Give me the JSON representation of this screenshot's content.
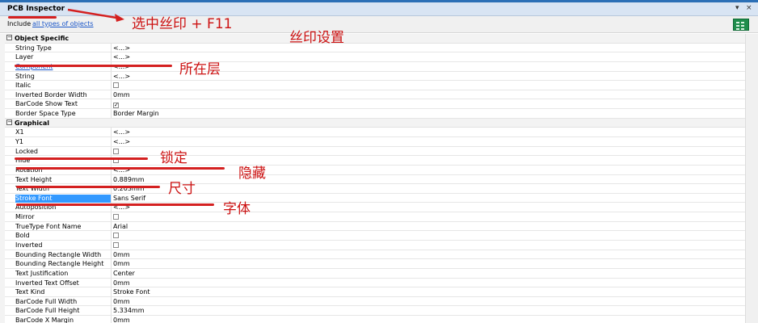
{
  "window": {
    "title": "PCB Inspector",
    "minimize_glyph": "▾",
    "close_glyph": "×"
  },
  "include_bar": {
    "label": "Include",
    "link": "all types of objects"
  },
  "sections": [
    {
      "title": "Object Specific",
      "toggle": "−",
      "rows": [
        {
          "name": "String Type",
          "value": "<...>"
        },
        {
          "name": "Layer",
          "value": "<...>"
        },
        {
          "name": "Component",
          "value": "<...>",
          "link": true
        },
        {
          "name": "String",
          "value": "<...>"
        },
        {
          "name": "Italic",
          "value": "",
          "checkbox": true,
          "checked": false
        },
        {
          "name": "Inverted Border Width",
          "value": "0mm"
        },
        {
          "name": "BarCode Show Text",
          "value": "",
          "checkbox": true,
          "checked": true
        },
        {
          "name": "Border Space Type",
          "value": "Border Margin"
        }
      ]
    },
    {
      "title": "Graphical",
      "toggle": "−",
      "rows": [
        {
          "name": "X1",
          "value": "<...>"
        },
        {
          "name": "Y1",
          "value": "<...>"
        },
        {
          "name": "Locked",
          "value": "",
          "checkbox": true,
          "checked": false
        },
        {
          "name": "Hide",
          "value": "",
          "checkbox": true,
          "checked": false
        },
        {
          "name": "Rotation",
          "value": "<...>"
        },
        {
          "name": "Text Height",
          "value": "0.889mm"
        },
        {
          "name": "Text Width",
          "value": "0.203mm"
        },
        {
          "name": "Stroke Font",
          "value": "Sans Serif",
          "selected": true
        },
        {
          "name": "Autoposition",
          "value": "<...>"
        },
        {
          "name": "Mirror",
          "value": "",
          "checkbox": true,
          "checked": false
        },
        {
          "name": "TrueType Font Name",
          "value": "Arial"
        },
        {
          "name": "Bold",
          "value": "",
          "checkbox": true,
          "checked": false
        },
        {
          "name": "Inverted",
          "value": "",
          "checkbox": true,
          "checked": false
        },
        {
          "name": "Bounding Rectangle Width",
          "value": "0mm"
        },
        {
          "name": "Bounding Rectangle Height",
          "value": "0mm"
        },
        {
          "name": "Text Justification",
          "value": "Center"
        },
        {
          "name": "Inverted Text Offset",
          "value": "0mm"
        },
        {
          "name": "Text Kind",
          "value": "Stroke Font"
        },
        {
          "name": "BarCode Full Width",
          "value": "0mm"
        },
        {
          "name": "BarCode Full Height",
          "value": "5.334mm"
        },
        {
          "name": "BarCode X Margin",
          "value": "0mm"
        }
      ]
    }
  ],
  "annotations": {
    "select_hint": "选中丝印 + F11",
    "silk_settings": "丝印设置",
    "layer_note": "所在层",
    "lock_note": "锁定",
    "hide_note": "隐藏",
    "size_note": "尺寸",
    "font_note": "字体"
  },
  "colors": {
    "annotation": "#cc1111",
    "selection": "#3399ff",
    "link": "#1a56c8",
    "accent": "#2b6fb6"
  }
}
